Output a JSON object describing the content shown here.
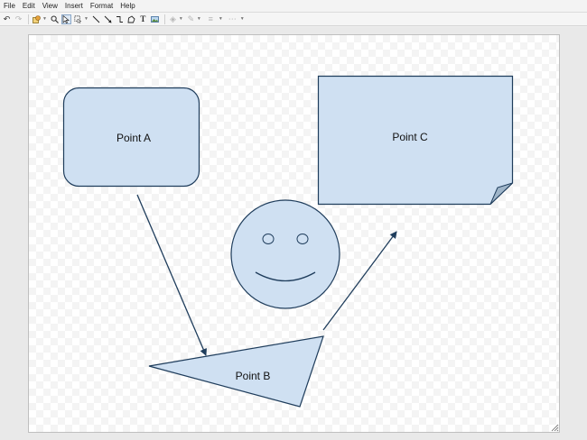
{
  "menubar": {
    "items": [
      {
        "label": "File"
      },
      {
        "label": "Edit"
      },
      {
        "label": "View"
      },
      {
        "label": "Insert"
      },
      {
        "label": "Format"
      },
      {
        "label": "Help"
      }
    ]
  },
  "toolbar": {
    "tools": [
      "undo-icon",
      "redo-icon",
      "shapes-icon",
      "zoom-icon",
      "pointer-icon",
      "lasso-icon",
      "line-icon",
      "arrow-icon",
      "connector-icon",
      "polygon-icon",
      "text-icon",
      "image-icon",
      "fill-color-icon",
      "line-color-icon",
      "line-weight-icon",
      "line-dash-icon"
    ]
  },
  "diagram": {
    "fill": "#cfe0f2",
    "stroke": "#1f3d5c",
    "shapes": {
      "point_a": {
        "label": "Point A",
        "type": "rounded-rectangle"
      },
      "point_b": {
        "label": "Point B",
        "type": "triangle"
      },
      "point_c": {
        "label": "Point C",
        "type": "note-page"
      },
      "smiley": {
        "type": "smiley-face"
      }
    },
    "connectors": [
      {
        "from": "Point A",
        "to": "Point B",
        "style": "arrow"
      },
      {
        "from": "Point B",
        "to": "Point C",
        "style": "arrow"
      }
    ]
  }
}
